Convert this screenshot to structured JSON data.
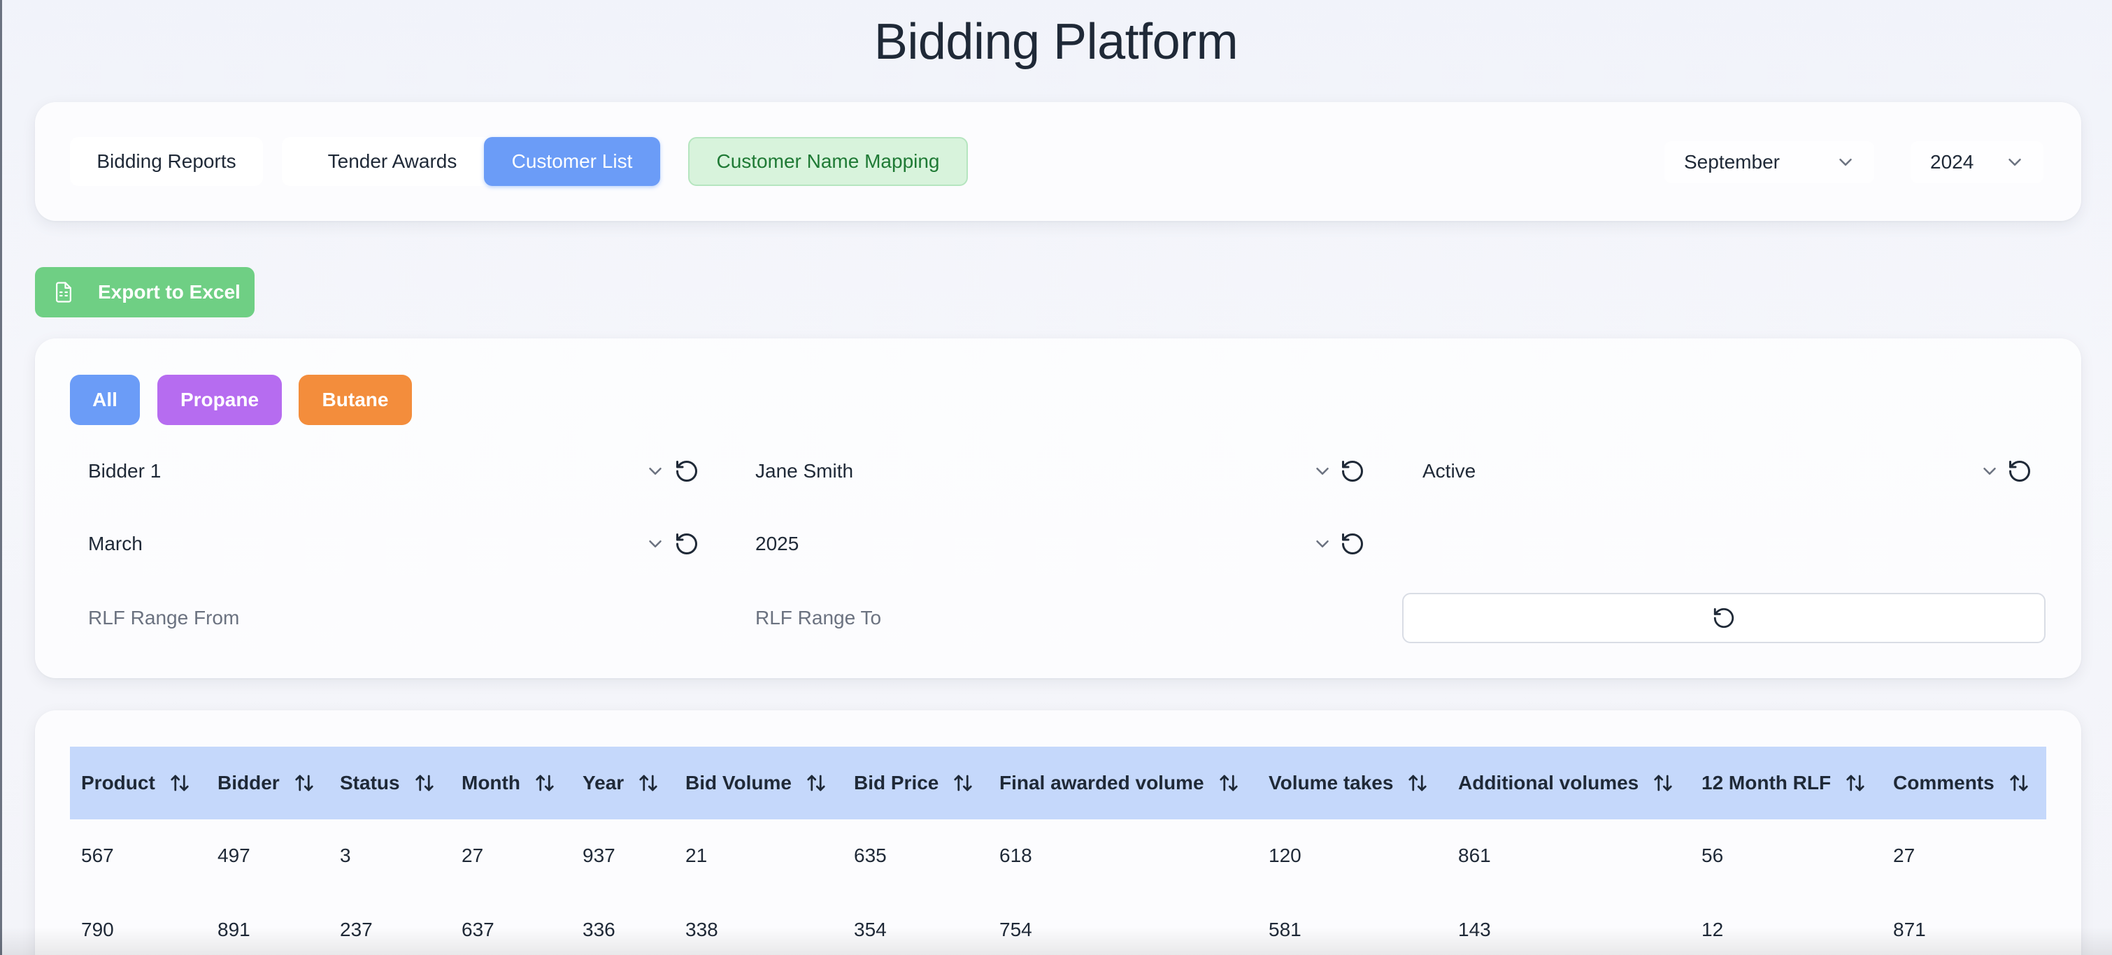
{
  "page": {
    "title": "Bidding Platform"
  },
  "nav": {
    "buttons": [
      {
        "label": "Bidding Reports",
        "active": false
      },
      {
        "label": "Tender Awards",
        "active": false
      },
      {
        "label": "Customer List",
        "active": true
      },
      {
        "label": "Customer Name Mapping",
        "active": false
      }
    ],
    "month": "September",
    "year": "2024"
  },
  "export": {
    "label": "Export to Excel"
  },
  "filters": {
    "product_pills": [
      "All",
      "Propane",
      "Butane"
    ],
    "bidder": "Bidder 1",
    "person": "Jane Smith",
    "status": "Active",
    "month": "March",
    "year": "2025",
    "rlf_from_placeholder": "RLF Range From",
    "rlf_to_placeholder": "RLF Range To"
  },
  "table": {
    "columns": [
      "Product",
      "Bidder",
      "Status",
      "Month",
      "Year",
      "Bid Volume",
      "Bid Price",
      "Final awarded volume",
      "Volume takes",
      "Additional volumes",
      "12 Month RLF",
      "Comments"
    ],
    "rows": [
      [
        "567",
        "497",
        "3",
        "27",
        "937",
        "21",
        "635",
        "618",
        "120",
        "861",
        "56",
        "27"
      ],
      [
        "790",
        "891",
        "237",
        "637",
        "336",
        "338",
        "354",
        "754",
        "581",
        "143",
        "12",
        "871"
      ]
    ]
  },
  "colors": {
    "primary": "#6b9cf7",
    "export_green": "#6fcf84",
    "propane": "#b66cf0",
    "butane": "#f38d3c",
    "mapping_bg": "#d8f3dc",
    "mapping_text": "#1f7a35",
    "table_header": "#c5d8fb"
  }
}
